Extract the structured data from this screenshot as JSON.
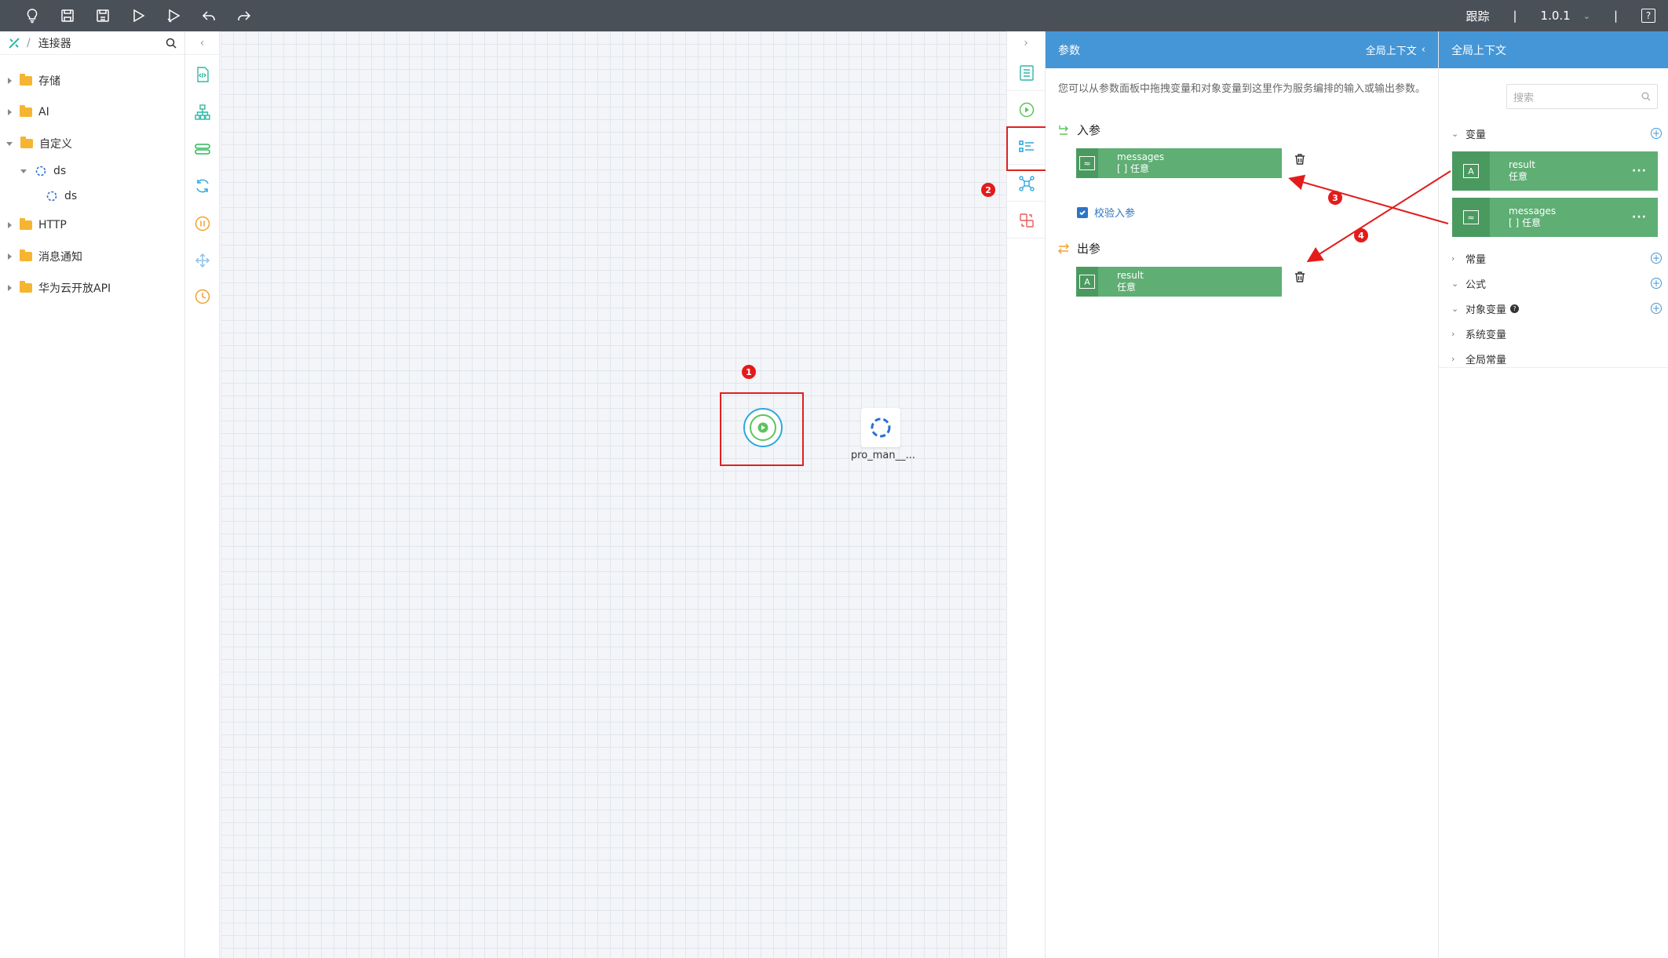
{
  "toolbar": {
    "trace_label": "跟踪",
    "separator": "|",
    "version": "1.0.1",
    "help_label": "?"
  },
  "connector_panel": {
    "breadcrumb_sep": "/",
    "title": "连接器",
    "tree": [
      {
        "label": "存储"
      },
      {
        "label": "AI"
      },
      {
        "label": "自定义"
      },
      {
        "label": "ds"
      },
      {
        "label": "ds"
      },
      {
        "label": "HTTP"
      },
      {
        "label": "消息通知"
      },
      {
        "label": "华为云开放API"
      }
    ]
  },
  "canvas": {
    "node_label": "pro_man__..."
  },
  "annotations": {
    "badge1": "1",
    "badge2": "2",
    "badge3": "3",
    "badge4": "4"
  },
  "param_panel": {
    "title": "参数",
    "context_link": "全局上下文",
    "description": "您可以从参数面板中拖拽变量和对象变量到这里作为服务编排的输入或输出参数。",
    "input_title": "入参",
    "input_param": {
      "name": "messages",
      "type": "[ ] 任意"
    },
    "validate_label": "校验入参",
    "output_title": "出参",
    "output_param": {
      "name": "result",
      "type": "任意"
    }
  },
  "context_panel": {
    "title": "全局上下文",
    "search_placeholder": "搜索",
    "variables_label": "变量",
    "variables": [
      {
        "name": "result",
        "type": "任意"
      },
      {
        "name": "messages",
        "type": "[ ] 任意"
      }
    ],
    "more": "···",
    "constants_label": "常量",
    "formula_label": "公式",
    "object_var_label": "对象变量",
    "system_var_label": "系统变量",
    "global_const_label": "全局常量"
  },
  "colors": {
    "topbar": "#4a5058",
    "panel_header": "#4596d6",
    "variable_card": "#5fae74",
    "annotation_red": "#e41b1b"
  }
}
